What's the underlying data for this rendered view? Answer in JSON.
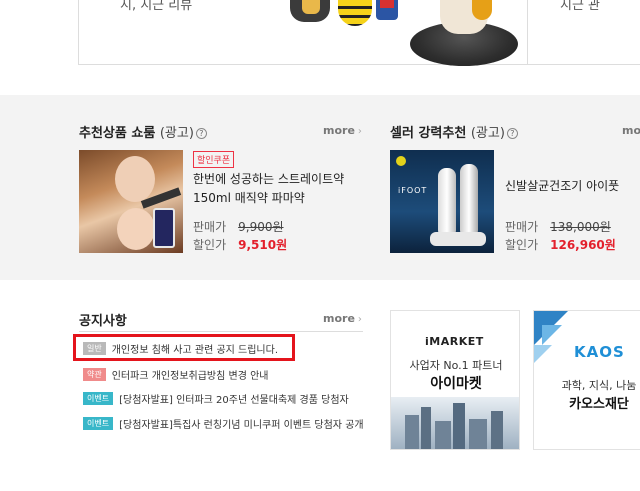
{
  "top": {
    "left_text": "지, 지근 리뷰",
    "right_text": "지근 관"
  },
  "recommend": {
    "title": "추천상품 쇼룸",
    "title_sub": "(광고)",
    "help": "?",
    "more": "more",
    "more_arrow": "›",
    "product": {
      "badge": "할인쿠폰",
      "name_line1": "한번에 성공하는 스트레이트약",
      "name_line2": "150ml 매직약 파마약",
      "price_label": "판매가",
      "price": "9,900원",
      "sale_label": "할인가",
      "sale_price": "9,510원"
    }
  },
  "seller": {
    "title": "셀러 강력추천",
    "title_sub": "(광고)",
    "help": "?",
    "more": "mo",
    "product": {
      "brand": "iFOOT",
      "name": "신발살균건조기 아이풋",
      "price_label": "판매가",
      "price": "138,000원",
      "sale_label": "할인가",
      "sale_price": "126,960원"
    }
  },
  "notice": {
    "title": "공지사항",
    "more": "more",
    "more_arrow": "›",
    "items": [
      {
        "tag": "일반",
        "text": "개인정보 침해 사고 관련 공지 드립니다."
      },
      {
        "tag": "약관",
        "text": "인터파크 개인정보취급방침 변경 안내"
      },
      {
        "tag": "이벤트",
        "text": "[당첨자발표] 인터파크 20주년 선물대축제 경품 당첨자"
      },
      {
        "tag": "이벤트",
        "text": "[당첨자발표]특집사 런칭기념 미니쿠퍼 이벤트 당첨자 공개"
      }
    ]
  },
  "partners": [
    {
      "logo": "iMARKET",
      "line1": "사업자 No.1 파트너",
      "line2": "아이마켓"
    },
    {
      "logo": "KAOS",
      "line1": "과학, 지식, 나눔",
      "line2": "카오스재단"
    }
  ],
  "colors": {
    "sale": "#e3202c",
    "highlight": "#e4141c",
    "tag_general": "#b9b9b9",
    "tag_terms": "#f08b8b",
    "tag_event": "#38b7c9",
    "kaos": "#1f8fd6",
    "imarket_i": "#e4141c"
  }
}
